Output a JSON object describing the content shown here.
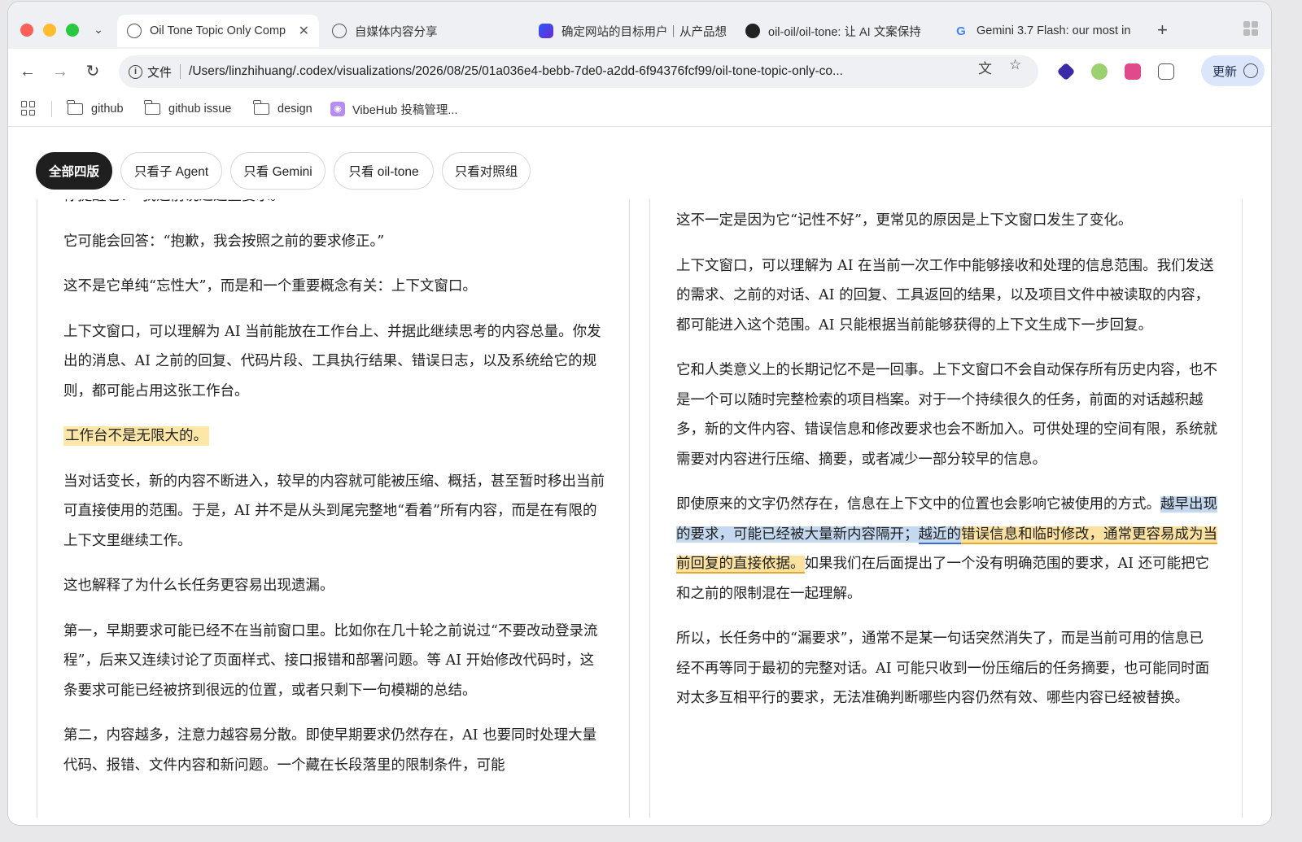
{
  "tabs": [
    {
      "title": "Oil Tone Topic Only Comp",
      "active": true,
      "favicon": "globe-icon"
    },
    {
      "title": "自媒体内容分享",
      "favicon": "globe-icon"
    },
    {
      "title": "确定网站的目标用户｜从产品想",
      "favicon": "app-icon"
    },
    {
      "title": "oil-oil/oil-tone: 让 AI 文案保持",
      "favicon": "github-icon"
    },
    {
      "title": "Gemini 3.7 Flash: our most in",
      "favicon": "google-icon"
    }
  ],
  "toolbar": {
    "info_label": "文件",
    "url": "/Users/linzhihuang/.codex/visualizations/2026/08/25/01a036e4-bebb-7de0-a2dd-6f94376fcf99/oil-tone-topic-only-co...",
    "update_label": "更新"
  },
  "bookmarks": [
    {
      "label": "github"
    },
    {
      "label": "github issue"
    },
    {
      "label": "design"
    },
    {
      "label": "VibeHub 投稿管理..."
    }
  ],
  "filters": [
    {
      "label": "全部四版",
      "active": true
    },
    {
      "label": "只看子 Agent"
    },
    {
      "label": "只看 Gemini"
    },
    {
      "label": "只看 oil-tone"
    },
    {
      "label": "只看对照组"
    }
  ],
  "left_column": {
    "p0": "你提醒它：“我之前说过这些要求。”",
    "p1": "它可能会回答：“抱歉，我会按照之前的要求修正。”",
    "p2": "这不是它单纯“忘性大”，而是和一个重要概念有关：上下文窗口。",
    "p3": "上下文窗口，可以理解为 AI 当前能放在工作台上、并据此继续思考的内容总量。你发出的消息、AI 之前的回复、代码片段、工具执行结果、错误日志，以及系统给它的规则，都可能占用这张工作台。",
    "p4": "工作台不是无限大的。",
    "p5": "当对话变长，新的内容不断进入，较早的内容就可能被压缩、概括，甚至暂时移出当前可直接使用的范围。于是，AI 并不是从头到尾完整地“看着”所有内容，而是在有限的上下文里继续工作。",
    "p6": "这也解释了为什么长任务更容易出现遗漏。",
    "p7": "第一，早期要求可能已经不在当前窗口里。比如你在几十轮之前说过“不要改动登录流程”，后来又连续讨论了页面样式、接口报错和部署问题。等 AI 开始修改代码时，这条要求可能已经被挤到很远的位置，或者只剩下一句模糊的总结。",
    "p8": "第二，内容越多，注意力越容易分散。即使早期要求仍然存在，AI 也要同时处理大量代码、报错、文件内容和新问题。一个藏在长段落里的限制条件，可能"
  },
  "right_column": {
    "p1": "这不一定是因为它“记性不好”，更常见的原因是上下文窗口发生了变化。",
    "p2": "上下文窗口，可以理解为 AI 在当前一次工作中能够接收和处理的信息范围。我们发送的需求、之前的对话、AI 的回复、工具返回的结果，以及项目文件中被读取的内容，都可能进入这个范围。AI 只能根据当前能够获得的上下文生成下一步回复。",
    "p3": "它和人类意义上的长期记忆不是一回事。上下文窗口不会自动保存所有历史内容，也不是一个可以随时完整检索的项目档案。对于一个持续很久的任务，前面的对话越积越多，新的文件内容、错误信息和修改要求也会不断加入。可供处理的空间有限，系统就需要对内容进行压缩、摘要，或者减少一部分较早的信息。",
    "p4_a": "即使原来的文字仍然存在，信息在上下文中的位置也会影响它被使用的方式。",
    "p4_b": "越早出现的要求，可能已经被大量新内容隔开；",
    "p4_c": "越近的",
    "p4_d": "错误信息和临时修改，通常更容易成为当前回复的直接依据。",
    "p4_e": "如果我们在后面提出了一个没有明确范围的要求，AI 还可能把它和之前的限制混在一起理解。",
    "p5": "所以，长任务中的“漏要求”，通常不是某一句话突然消失了，而是当前可用的信息已经不再等同于最初的完整对话。AI 可能只收到一份压缩后的任务摘要，也可能同时面对太多互相平行的要求，无法准确判断哪些内容仍然有效、哪些内容已经被替换。"
  },
  "colors": {
    "active_pill": "#1f1f1f",
    "highlight_yellow": "#fde7a8",
    "highlight_blue": "#c4d8f0",
    "underline_blue": "#3a6fd1",
    "update_button": "#dbe6fb"
  }
}
